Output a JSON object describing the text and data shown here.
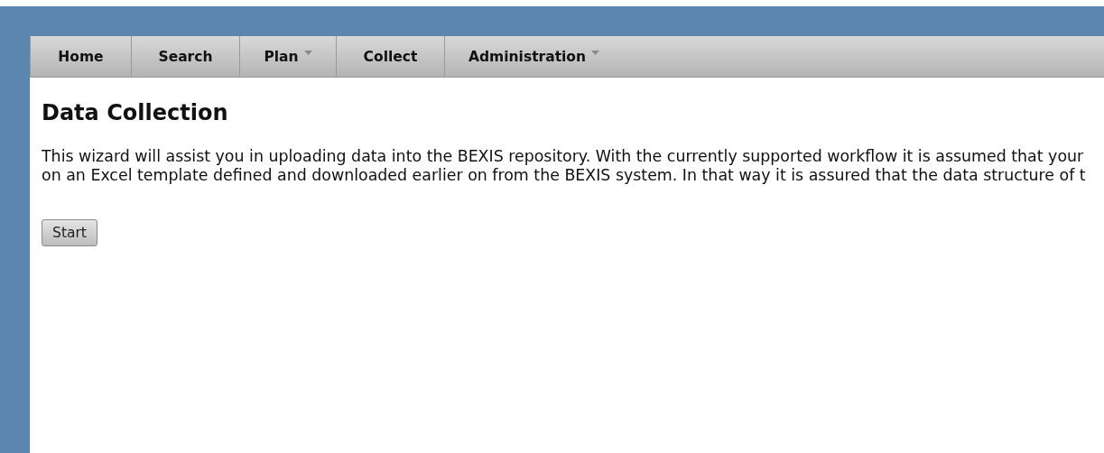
{
  "menu": [
    {
      "label": "Home",
      "dropdown": false
    },
    {
      "label": "Search",
      "dropdown": false
    },
    {
      "label": "Plan",
      "dropdown": true
    },
    {
      "label": "Collect",
      "dropdown": false
    },
    {
      "label": "Administration",
      "dropdown": true
    }
  ],
  "page": {
    "title": "Data Collection",
    "intro_lines": [
      "This wizard will assist you in uploading data into the BEXIS repository. With the currently supported workflow it is assumed that your",
      "on an Excel template defined and downloaded earlier on from the BEXIS system. In that way it is assured that the data structure of t"
    ],
    "start_button": "Start"
  }
}
